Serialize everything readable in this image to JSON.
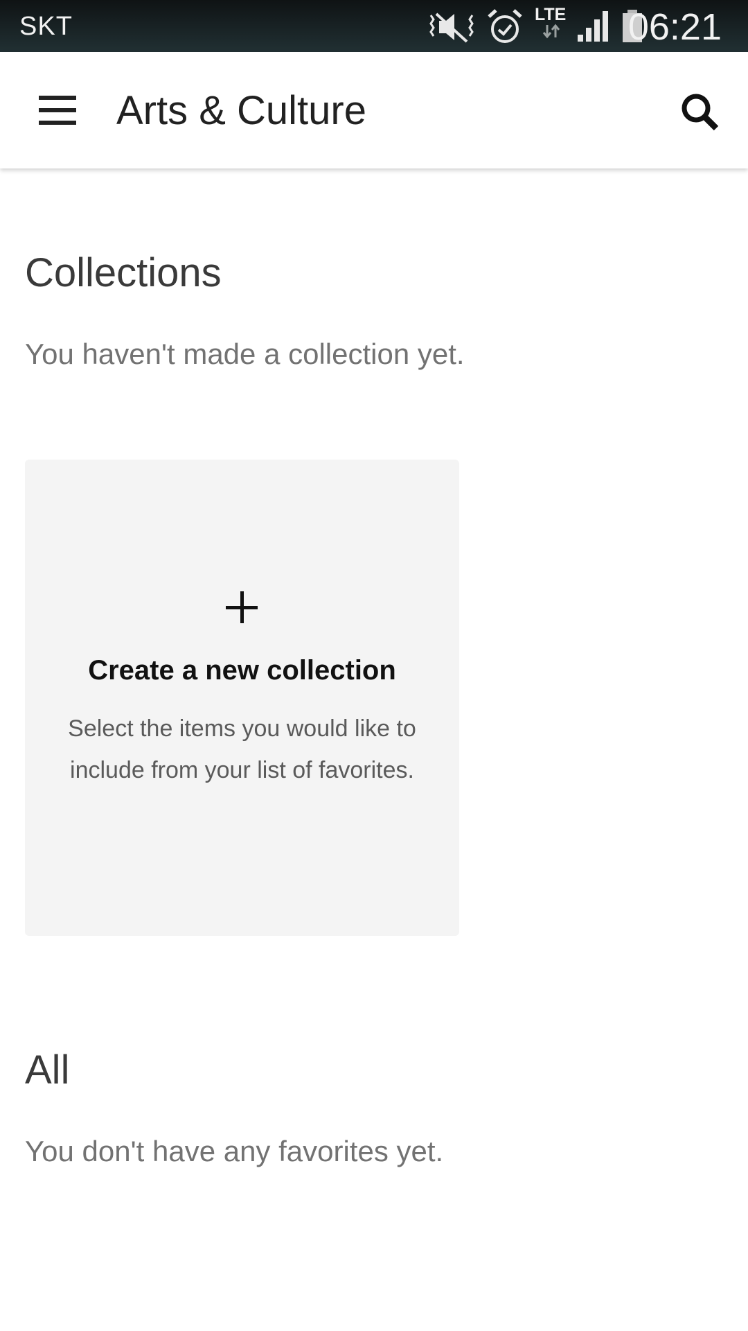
{
  "status_bar": {
    "carrier": "SKT",
    "network": "LTE",
    "time": "06:21",
    "icons": [
      "mute-icon",
      "alarm-icon",
      "lte-icon",
      "signal-icon",
      "battery-icon"
    ]
  },
  "app_bar": {
    "title": "Arts & Culture",
    "menu_icon": "hamburger-menu-icon",
    "search_icon": "search-icon"
  },
  "collections": {
    "title": "Collections",
    "empty_text": "You haven't made a collection yet.",
    "card": {
      "icon": "plus-icon",
      "title": "Create a new collection",
      "description": "Select the items you would like to include from your list of favorites."
    }
  },
  "all": {
    "title": "All",
    "empty_text": "You don't have any favorites yet."
  },
  "colors": {
    "status_bar": "#1a2426",
    "card_background": "#f4f4f4",
    "title_text": "#212121",
    "secondary_text": "#727272"
  }
}
